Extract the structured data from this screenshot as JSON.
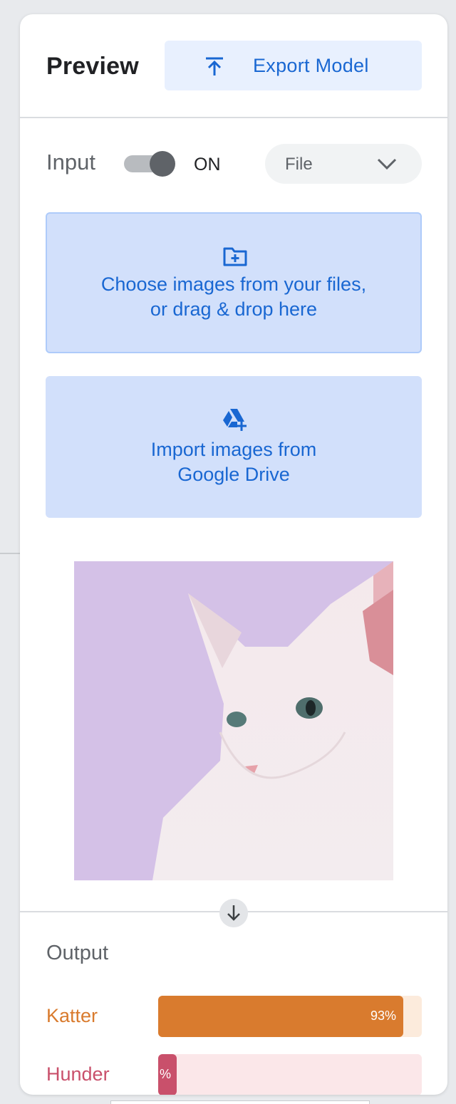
{
  "header": {
    "title": "Preview",
    "export_label": "Export Model",
    "export_icon": "upload-icon"
  },
  "input": {
    "label": "Input",
    "toggle_on": true,
    "toggle_state_label": "ON",
    "source_select": {
      "value": "File",
      "icon": "chevron-down-icon"
    },
    "file_drop": {
      "icon": "folder-plus-icon",
      "line1": "Choose images from your files,",
      "line2": "or drag & drop here"
    },
    "drive_import": {
      "icon": "drive-add-icon",
      "line1": "Import images from",
      "line2": "Google Drive"
    },
    "preview_image": "sphynx-cat-photo"
  },
  "output": {
    "label": "Output",
    "divider_icon": "arrow-down-icon",
    "classes": [
      {
        "label": "Katter",
        "percent_text": "93%",
        "fraction": 0.93,
        "color": "#d97b2e",
        "track_color": "#fcebdc"
      },
      {
        "label": "Hunder",
        "percent_text": "%",
        "fraction": 0.07,
        "color": "#c9506b",
        "track_color": "#fbe7e9"
      }
    ]
  }
}
